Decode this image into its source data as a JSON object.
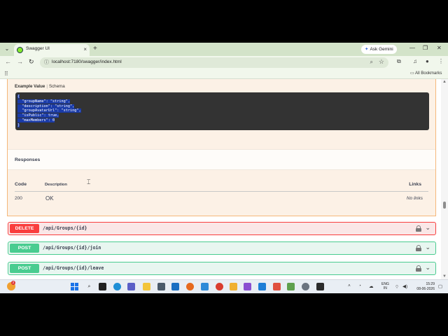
{
  "browser": {
    "tab_title": "Swagger UI",
    "tab_close": "×",
    "new_tab": "+",
    "ask_gemini": "Ask Gemini",
    "url": "localhost:7180/swagger/index.html",
    "all_bookmarks": "All Bookmarks",
    "win_min": "—",
    "win_max": "❐",
    "win_close": "✕"
  },
  "request_body": {
    "tabs": [
      "Example Value",
      "Schema"
    ],
    "separator": "|",
    "code_lines": [
      "{",
      "  \"groupName\": \"string\",",
      "  \"description\": \"string\",",
      "  \"groupAvatarUrl\": \"string\",",
      "  \"isPublic\": true,",
      "  \"maxMembers\": 0",
      "}"
    ]
  },
  "responses": {
    "title": "Responses",
    "headers": {
      "code": "Code",
      "description": "Description",
      "links": "Links"
    },
    "rows": [
      {
        "code": "200",
        "description": "OK",
        "links": "No links"
      }
    ]
  },
  "operations": [
    {
      "method": "DELETE",
      "path": "/api/Groups/{id}",
      "color": "#f93e3e"
    },
    {
      "method": "POST",
      "path": "/api/Groups/{id}/join",
      "color": "#49cc90"
    },
    {
      "method": "POST",
      "path": "/api/Groups/{id}/leave",
      "color": "#49cc90"
    }
  ],
  "taskbar": {
    "weather_badge": "2",
    "lang": "ENG",
    "region": "IN",
    "time": "15:29",
    "date": "08-06-2026",
    "apps": [
      "windows-start",
      "search",
      "task-view",
      "edge",
      "teams",
      "file-explorer",
      "calculator",
      "outlook",
      "firefox",
      "notepad",
      "chrome",
      "paint",
      "visual-studio",
      "vscode",
      "snipping-tool",
      "nodejs",
      "settings",
      "terminal"
    ]
  }
}
